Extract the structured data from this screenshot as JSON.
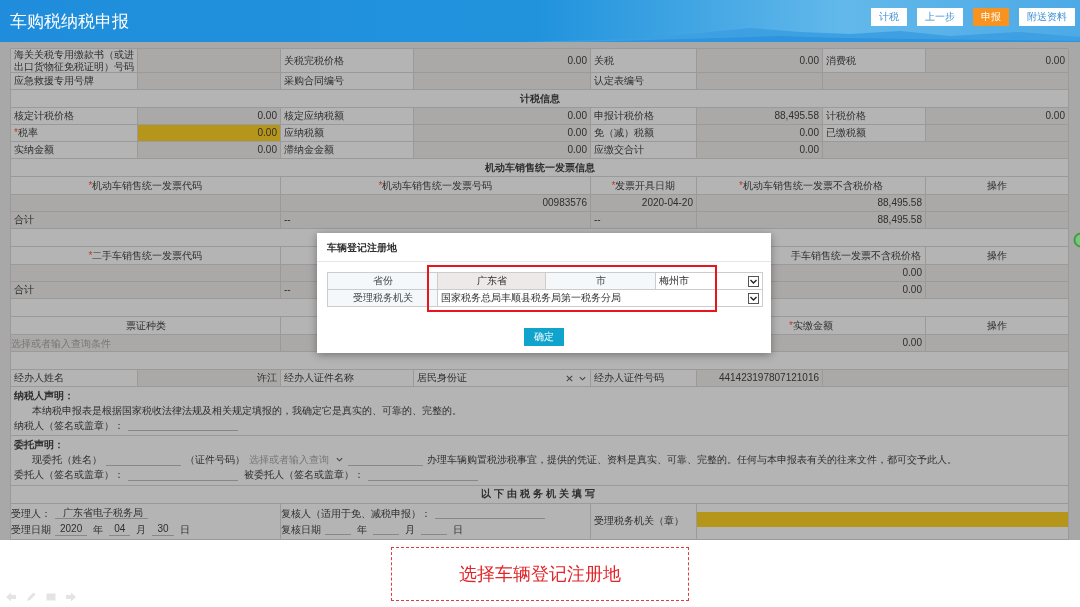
{
  "header": {
    "title": "车购税纳税申报",
    "buttons": [
      {
        "label": "计税",
        "selected": false
      },
      {
        "label": "上一步",
        "selected": false
      },
      {
        "label": "申报",
        "selected": true
      },
      {
        "label": "附送资料",
        "selected": false
      }
    ]
  },
  "form": {
    "rows": [
      {
        "kind": "fields",
        "cells": [
          {
            "kind": "value",
            "label": "海关关税专用缴款书（或进出口货物征免税证明）号码",
            "highlighted": false
          },
          {
            "kind": "value",
            "label": "关税完税价格",
            "value": "0.00",
            "highlighted": false
          },
          {
            "kind": "value",
            "label": "关税",
            "value": "0.00",
            "highlighted": false
          },
          {
            "kind": "value",
            "label": "消费税",
            "value": "0.00",
            "highlighted": false
          }
        ]
      },
      {
        "kind": "fields",
        "cells": [
          {
            "kind": "value",
            "label": "应急救援专用号牌",
            "highlighted": false
          },
          {
            "kind": "value",
            "label": "采购合同编号",
            "highlighted": false
          },
          {
            "kind": "value",
            "label": "认定表编号",
            "highlighted": false
          }
        ]
      },
      {
        "kind": "section",
        "title": "计税信息"
      },
      {
        "kind": "fields",
        "cells": [
          {
            "kind": "value",
            "label": "核定计税价格",
            "value": "0.00",
            "highlighted": false
          },
          {
            "kind": "value",
            "label": "核定应纳税额",
            "value": "0.00",
            "highlighted": false
          },
          {
            "kind": "value",
            "label": "申报计税价格",
            "value": "88,495.58",
            "highlighted": false
          },
          {
            "kind": "value",
            "label": "计税价格",
            "value": "0.00",
            "highlighted": false
          }
        ]
      },
      {
        "kind": "fields",
        "cells": [
          {
            "kind": "value",
            "mark": "*",
            "label": "税率",
            "value": "0.00",
            "highlighted": true
          },
          {
            "kind": "value",
            "label": "应纳税额",
            "value": "0.00",
            "highlighted": false
          },
          {
            "kind": "value",
            "label": "免（减）税额",
            "value": "0.00",
            "highlighted": false
          },
          {
            "kind": "value",
            "label": "已缴税额",
            "highlighted": false
          }
        ]
      },
      {
        "kind": "fields",
        "cells": [
          {
            "kind": "value",
            "label": "实纳金额",
            "value": "0.00",
            "highlighted": false
          },
          {
            "kind": "value",
            "label": "滞纳金金额",
            "value": "0.00",
            "highlighted": false
          },
          {
            "kind": "value",
            "label": "应缴交合计",
            "value": "0.00",
            "highlighted": false
          }
        ]
      },
      {
        "kind": "section",
        "title": "机动车销售统一发票信息"
      },
      {
        "kind": "head",
        "code": {
          "mark": "*",
          "text": "机动车销售统一发票代码"
        },
        "number": {
          "mark": "*",
          "text": "机动车销售统一发票号码"
        },
        "date": {
          "mark": "*",
          "text": "发票开具日期"
        },
        "price": {
          "mark": "*",
          "text": "机动车销售统一发票不含税价格"
        },
        "action": {
          "text": "操作"
        }
      },
      {
        "kind": "data",
        "number": "00983576",
        "date": "2020-04-20",
        "price": "88,495.58"
      },
      {
        "kind": "total",
        "code": "合计",
        "number": "--",
        "date": "--",
        "price": "88,495.58"
      },
      {
        "kind": "section"
      },
      {
        "kind": "head",
        "code": {
          "mark": "*",
          "text": "二手车销售统一发票代码"
        },
        "price": {
          "text": "手车销售统一发票不含税价格",
          "partial": true
        },
        "action": {
          "text": "操作"
        }
      },
      {
        "kind": "data",
        "price": "0.00"
      },
      {
        "kind": "total",
        "code": "合计",
        "number": "--",
        "price": "0.00"
      },
      {
        "kind": "section"
      },
      {
        "kind": "head",
        "code": {
          "text": "票证种类"
        },
        "price": {
          "mark": "*",
          "text": "实缴金额"
        },
        "action": {
          "text": "操作"
        }
      },
      {
        "kind": "data",
        "placeholder": "选择或者输入查询条件",
        "price": "0.00"
      },
      {
        "kind": "section"
      },
      {
        "kind": "fields",
        "cells": [
          {
            "kind": "value",
            "label": "经办人姓名",
            "value": "许江",
            "highlighted": false
          },
          {
            "kind": "select",
            "label": "经办人证件名称",
            "value": "居民身份证",
            "highlighted": false
          },
          {
            "kind": "value",
            "label": "经办人证件号码",
            "value": "441423197807121016",
            "highlighted": false
          }
        ]
      }
    ]
  },
  "taxpayer_declaration": {
    "title": "纳税人声明：",
    "text": "本纳税申报表是根据国家税收法律法规及相关规定填报的，我确定它是真实的、可靠的、完整的。",
    "signature_label": "纳税人（签名或盖章）："
  },
  "delegation": {
    "title": "委托声明：",
    "name_label": "现委托（姓名）",
    "id_label": "（证件号码）",
    "id_type_placeholder": "选择或者输入查询",
    "statement": "办理车辆购置税涉税事宜，提供的凭证、资料是真实、可靠、完整的。任何与本申报表有关的往来文件，都可交予此人。",
    "delegator_label": "委托人（签名或盖章）：",
    "delegate_label": "被委托人（签名或盖章）："
  },
  "official": {
    "title": "以下由税务机关填写",
    "acceptor_label": "受理人：",
    "acceptor": "广东省电子税务局",
    "accept_date_label": "受理日期",
    "accept_date": [
      {
        "value": "2020",
        "unit": "年"
      },
      {
        "value": "04",
        "unit": "月"
      },
      {
        "value": "30",
        "unit": "日"
      }
    ],
    "reviewer_label": "复核人（适用于免、减税申报）：",
    "review_date_label": "复核日期",
    "review_date_units": [
      "年",
      "月",
      "日"
    ],
    "seal_label": "受理税务机关（章）",
    "seal_highlighted": true
  },
  "dialog": {
    "title": "车辆登记注册地",
    "province_label": "省份",
    "province": "广东省",
    "city_label": "市",
    "city": "梅州市",
    "office_label": "受理税务机关",
    "office": "国家税务总局丰顺县税务局第一税务分局",
    "confirm": "确定"
  },
  "caption": "选择车辆登记注册地"
}
